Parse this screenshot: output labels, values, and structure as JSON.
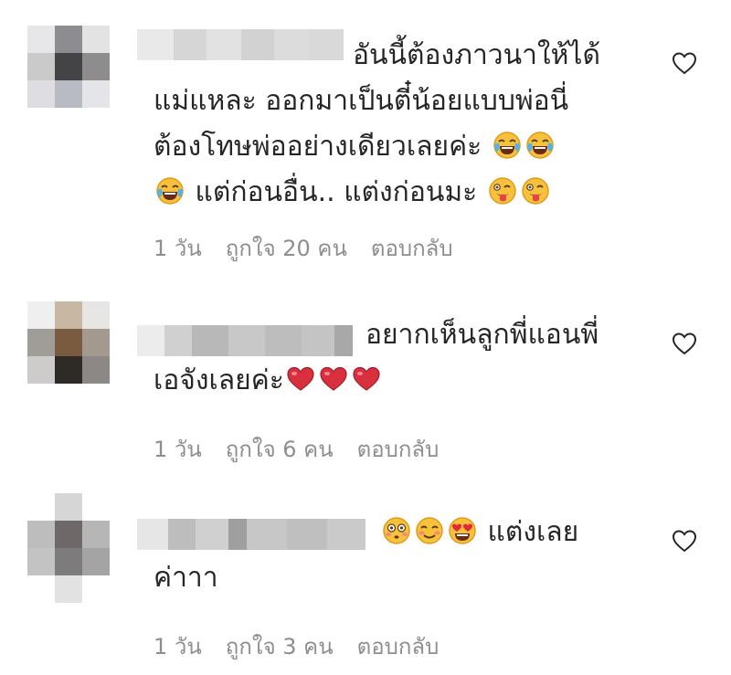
{
  "colors": {
    "text": "#262626",
    "meta": "#8e8e8e",
    "background": "#ffffff"
  },
  "comments": [
    {
      "text_lines": [
        "อันนี้ต้องภาวนาให้ได้",
        "แม่แหละ ออกมาเป็นตี๋น้อยแบบพ่อนี่",
        "ต้องโทษพ่ออย่างเดียวเลยค่ะ",
        "แต่ก่อนอื่น.. แต่งก่อนมะ"
      ],
      "emojis_line3": [
        "tears-of-joy-icon",
        "tears-of-joy-icon"
      ],
      "emojis_line4_lead": [
        "tears-of-joy-icon"
      ],
      "emojis_line4_trail": [
        "winking-tongue-icon",
        "winking-tongue-icon"
      ],
      "time": "1 วัน",
      "likes": "ถูกใจ 20 คน",
      "reply": "ตอบกลับ"
    },
    {
      "text_lines": [
        "อยากเห็นลูกพี่แอนพี่",
        "เอจังเลยค่ะ"
      ],
      "emojis_line2": [
        "heart-icon",
        "heart-icon",
        "heart-icon"
      ],
      "time": "1 วัน",
      "likes": "ถูกใจ 6 คน",
      "reply": "ตอบกลับ"
    },
    {
      "text_lines": [
        "แต่งเลย",
        "ค่าาา"
      ],
      "emojis_line1_lead": [
        "flushed-face-icon",
        "smiling-blush-icon",
        "heart-eyes-icon"
      ],
      "time": "1 วัน",
      "likes": "ถูกใจ 3 คน",
      "reply": "ตอบกลับ"
    }
  ]
}
